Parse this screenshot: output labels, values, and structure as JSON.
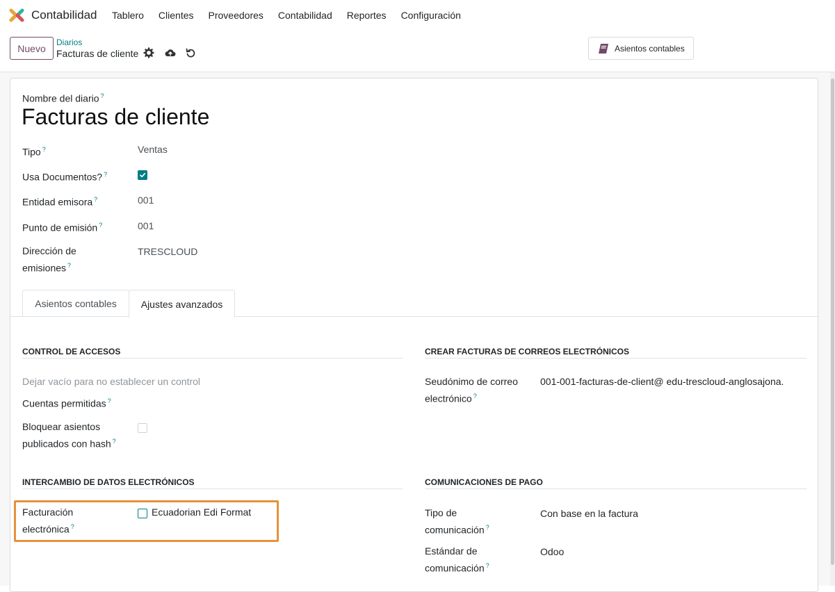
{
  "navbar": {
    "app_name": "Contabilidad",
    "menu": [
      "Tablero",
      "Clientes",
      "Proveedores",
      "Contabilidad",
      "Reportes",
      "Configuración"
    ]
  },
  "controlbar": {
    "new_label": "Nuevo",
    "breadcrumb_parent": "Diarios",
    "breadcrumb_current": "Facturas de cliente",
    "smart_button_label": "Asientos contables"
  },
  "form": {
    "journal_name_label": "Nombre del diario",
    "journal_name": "Facturas de cliente",
    "help_mark": "?",
    "fields": {
      "tipo_label": "Tipo",
      "tipo_value": "Ventas",
      "usa_documentos_label": "Usa Documentos?",
      "usa_documentos_checked": true,
      "entidad_label": "Entidad emisora",
      "entidad_value": "001",
      "punto_label": "Punto de emisión",
      "punto_value": "001",
      "direccion_label_1": "Dirección de",
      "direccion_label_2": "emisiones",
      "direccion_value": "TRESCLOUD"
    },
    "tabs": [
      "Asientos contables",
      "Ajustes avanzados"
    ],
    "active_tab": "Ajustes avanzados"
  },
  "advanced": {
    "access_control": {
      "title": "CONTROL DE ACCESOS",
      "placeholder": "Dejar vacío para no establecer un control",
      "allowed_accounts_label": "Cuentas permitidas",
      "lock_label_1": "Bloquear asientos",
      "lock_label_2": "publicados con hash",
      "lock_checked": false
    },
    "email_invoices": {
      "title": "CREAR FACTURAS DE CORREOS ELECTRÓNICOS",
      "alias_label_1": "Seudónimo de correo",
      "alias_label_2": "electrónico",
      "alias_prefix": "001-001-facturas-de-client",
      "alias_domain": "@ edu-trescloud-anglosajona."
    },
    "edi": {
      "title": "INTERCAMBIO DE DATOS ELECTRÓNICOS",
      "label_1": "Facturación",
      "label_2": "electrónica",
      "option_label": "Ecuadorian Edi Format",
      "option_checked": false
    },
    "payment": {
      "title": "COMUNICACIONES DE PAGO",
      "type_label_1": "Tipo de",
      "type_label_2": "comunicación",
      "type_value": "Con base en la factura",
      "standard_label_1": "Estándar de",
      "standard_label_2": "comunicación",
      "standard_value": "Odoo"
    }
  },
  "colors": {
    "brand": "#714b67",
    "accent": "#017e84",
    "highlight": "#e5923b"
  }
}
